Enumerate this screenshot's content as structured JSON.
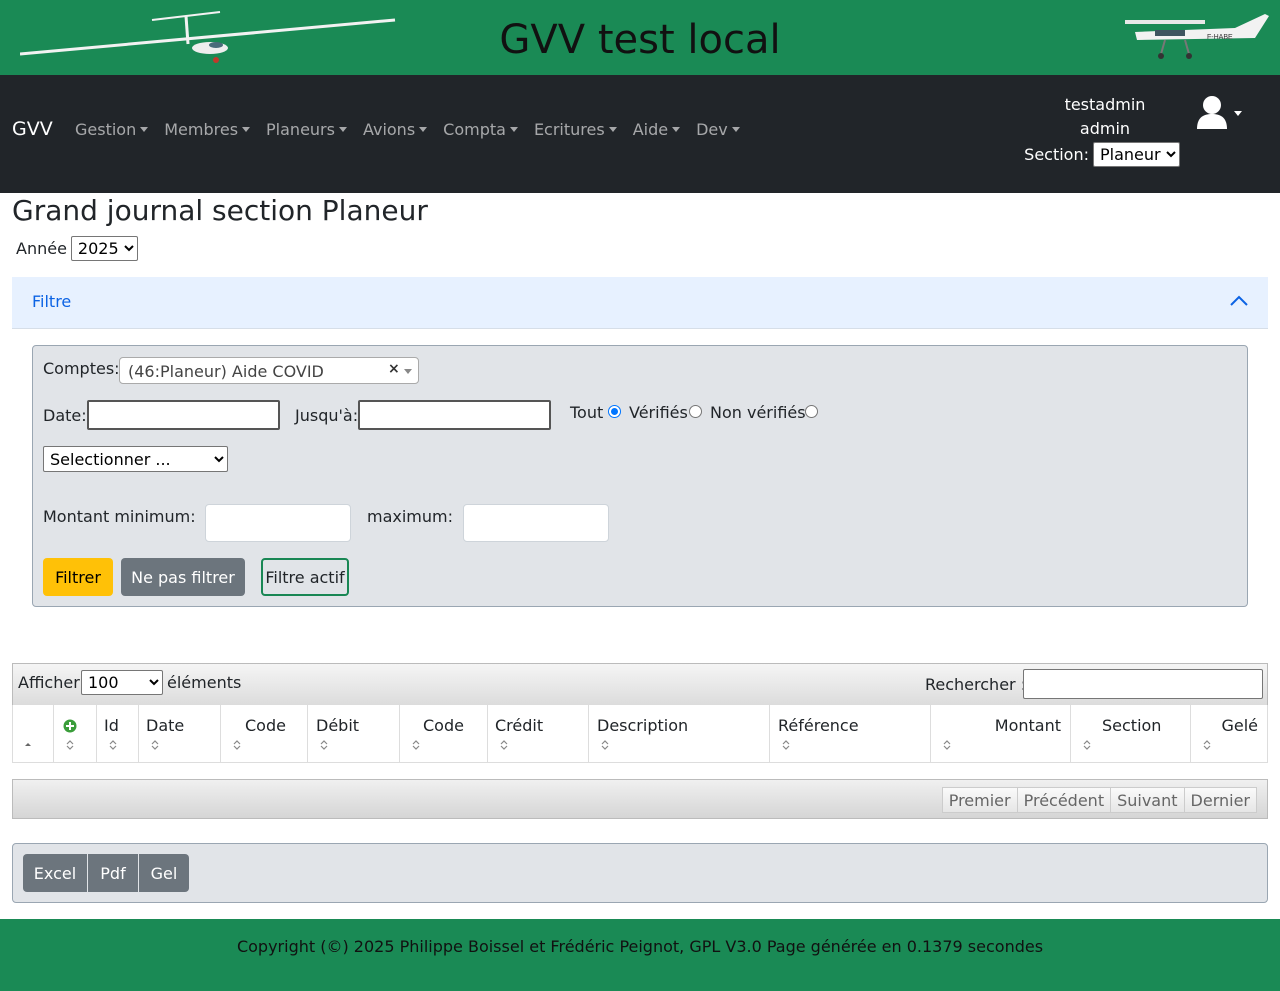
{
  "header": {
    "title": "GVV test local",
    "plane_registration": "F-HABE"
  },
  "navbar": {
    "brand": "GVV",
    "menus": [
      "Gestion",
      "Membres",
      "Planeurs",
      "Avions",
      "Compta",
      "Ecritures",
      "Aide",
      "Dev"
    ],
    "user_name": "testadmin",
    "user_role": "admin",
    "section_label": "Section:",
    "section_value": "Planeur"
  },
  "page": {
    "title": "Grand journal section Planeur",
    "year_label": "Année",
    "year_value": "2025"
  },
  "filter": {
    "accordion_label": "Filtre",
    "accounts_label": "Comptes:",
    "accounts_value": "(46:Planeur) Aide COVID",
    "date_label": "Date:",
    "date_value": "",
    "until_label": "Jusqu'à:",
    "until_value": "",
    "radio_all": "Tout",
    "radio_verified": "Vérifiés",
    "radio_unverified": "Non vérifiés",
    "radio_selected": "Tout",
    "select_placeholder": "Selectionner ...",
    "min_label": "Montant minimum:",
    "max_label": "maximum:",
    "min_value": "",
    "max_value": "",
    "btn_filter": "Filtrer",
    "btn_no_filter": "Ne pas filtrer",
    "btn_active": "Filtre actif"
  },
  "table": {
    "show_label": "Afficher",
    "show_value": "100",
    "elements_label": "éléments",
    "search_label": "Rechercher :",
    "search_value": "",
    "columns": [
      "Id",
      "Date",
      "Code",
      "Débit",
      "Code",
      "Crédit",
      "Description",
      "Référence",
      "Montant",
      "Section",
      "Gelé"
    ],
    "rows": [],
    "pager": [
      "Premier",
      "Précédent",
      "Suivant",
      "Dernier"
    ]
  },
  "exports": [
    "Excel",
    "Pdf",
    "Gel"
  ],
  "footer": {
    "text": "Copyright (©) 2025 Philippe Boissel et Frédéric Peignot, GPL V3.0 Page générée en 0.1379 secondes"
  },
  "colors": {
    "header_green": "#1a8a55",
    "navbar_dark": "#212529",
    "accordion_bg": "#e7f1ff",
    "accordion_text": "#0c63e4",
    "warning": "#ffc107",
    "secondary": "#6c757d",
    "success": "#198754"
  },
  "icons": {
    "user": "user-icon",
    "chevron": "chevron-up-icon",
    "sort": "sort-icon",
    "add": "add-circle-icon"
  }
}
